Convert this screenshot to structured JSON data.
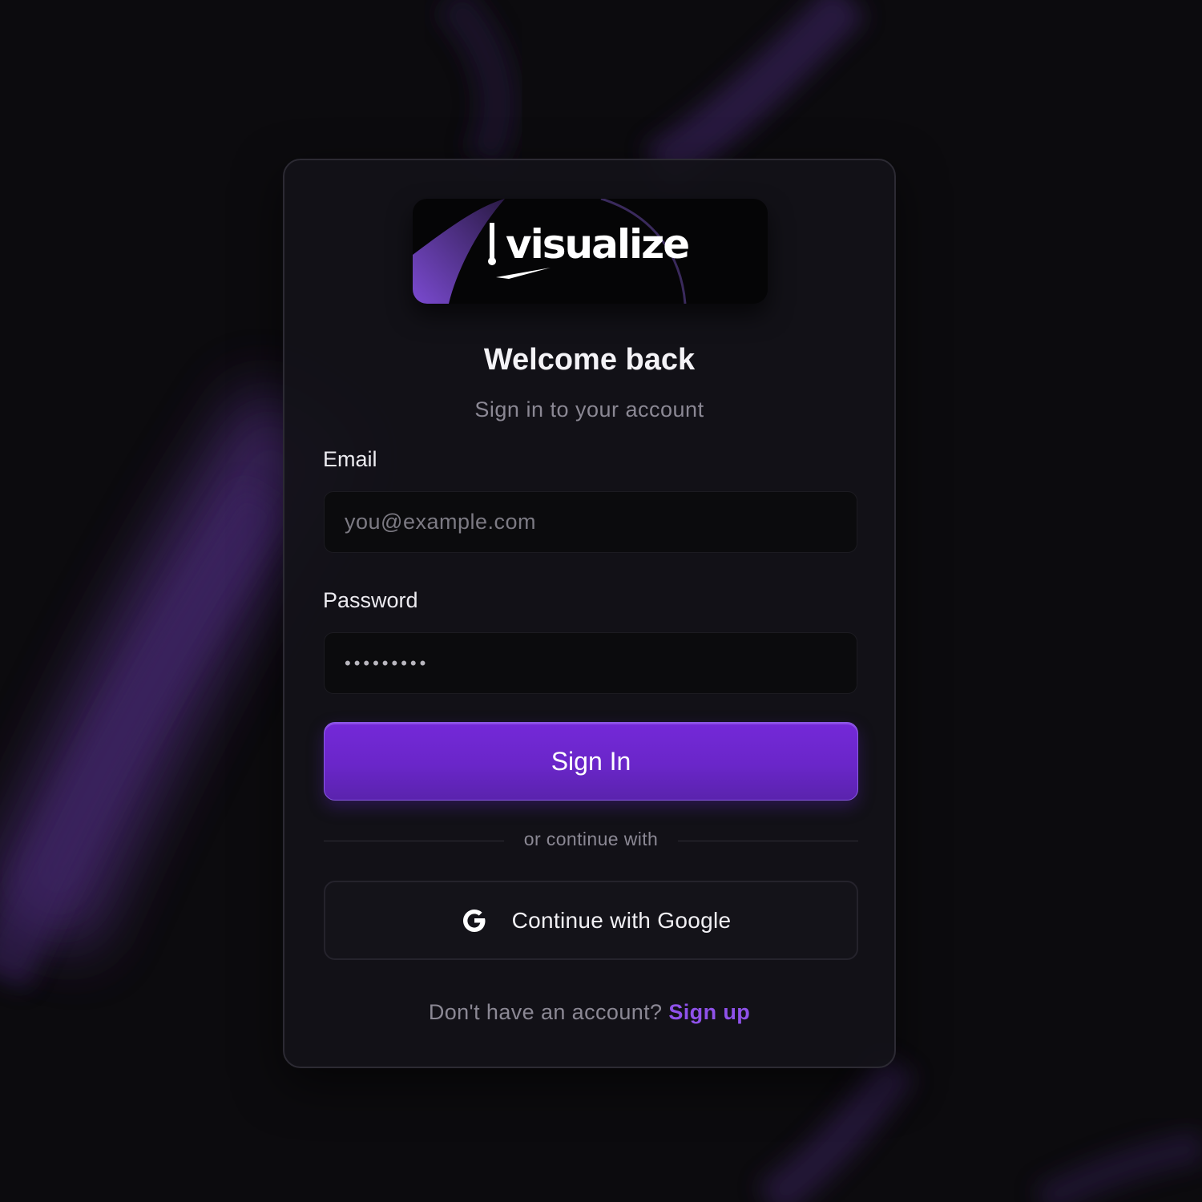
{
  "brand": {
    "logo_text": "visualize",
    "accent_color": "#7429d8",
    "link_color": "#8f52ea"
  },
  "header": {
    "title": "Welcome back",
    "subtitle": "Sign in to your account"
  },
  "form": {
    "email_label": "Email",
    "email_placeholder": "you@example.com",
    "email_value": "",
    "password_label": "Password",
    "password_value": "•••••••••",
    "submit_label": "Sign In"
  },
  "divider": {
    "text": "or continue with"
  },
  "oauth": {
    "google_label": "Continue with Google",
    "google_icon": "google-g-icon"
  },
  "footer": {
    "prompt": "Don't have an account?",
    "signup_label": "Sign up"
  }
}
